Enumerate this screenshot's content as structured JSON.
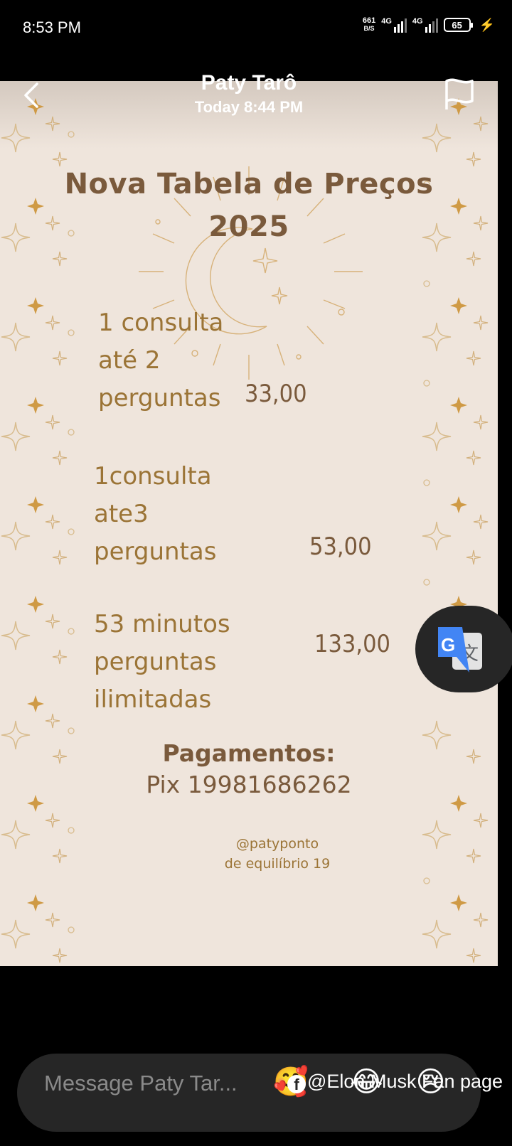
{
  "status": {
    "time": "8:53 PM",
    "net_speed_value": "661",
    "net_speed_unit": "B/S",
    "sim1": "4G",
    "sim2": "4G",
    "battery": "65"
  },
  "chat": {
    "name": "Paty Tarô",
    "time": "Today 8:44 PM"
  },
  "image": {
    "title_line1": "Nova Tabela de Preços",
    "title_line2": "2025",
    "items": [
      {
        "lines": [
          "1 consulta",
          "até 2",
          "perguntas"
        ],
        "price": "33,00"
      },
      {
        "lines": [
          "1consulta",
          "ate3",
          "perguntas"
        ],
        "price": "53,00"
      },
      {
        "lines": [
          "53 minutos",
          "perguntas",
          "ilimitadas"
        ],
        "price": "133,00"
      }
    ],
    "payments_title": "Pagamentos:",
    "pix": "Pix 19981686262",
    "handle_line1": "@patyponto",
    "handle_line2": "de equilíbrio 19"
  },
  "composer": {
    "placeholder": "Message Paty Tar...",
    "overlay_text": "@Elon Musk Fan page",
    "emojis": [
      "🥰",
      "😂",
      "😢"
    ]
  }
}
